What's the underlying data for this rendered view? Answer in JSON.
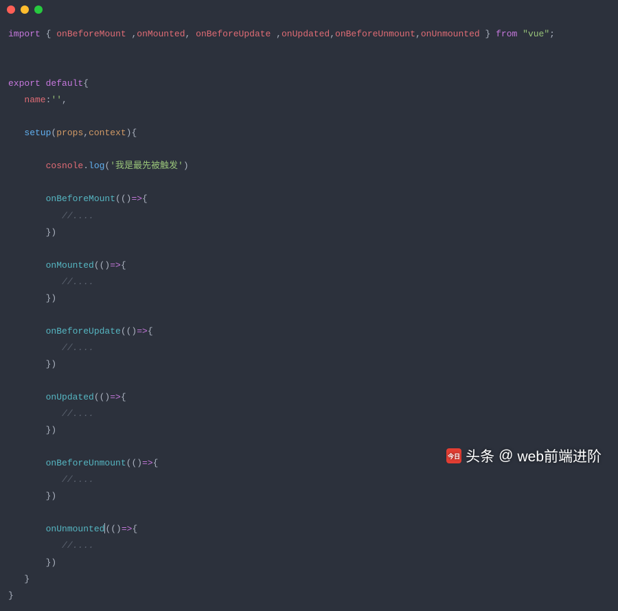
{
  "code": {
    "import_kw": "import",
    "lbrace": "{",
    "imports": [
      "onBeforeMount",
      "onMounted",
      "onBeforeUpdate",
      "onUpdated",
      "onBeforeUnmount",
      "onUnmounted"
    ],
    "rbrace": "}",
    "from_kw": "from",
    "vue_str": "\"vue\"",
    "export_kw": "export",
    "default_kw": "default",
    "name_prop": "name",
    "name_val": "''",
    "setup": "setup",
    "props": "props",
    "context": "context",
    "cosnole": "cosnole",
    "log": "log",
    "log_str": "'我是最先被触发'",
    "hooks": [
      "onBeforeMount",
      "onMounted",
      "onBeforeUpdate",
      "onUpdated",
      "onBeforeUnmount",
      "onUnmounted"
    ],
    "comment": "//....",
    "arrow": "=>",
    "close_paren_brace": "})"
  },
  "watermark": {
    "label_prefix": "头条",
    "at": "@",
    "handle": "web前端进阶"
  }
}
